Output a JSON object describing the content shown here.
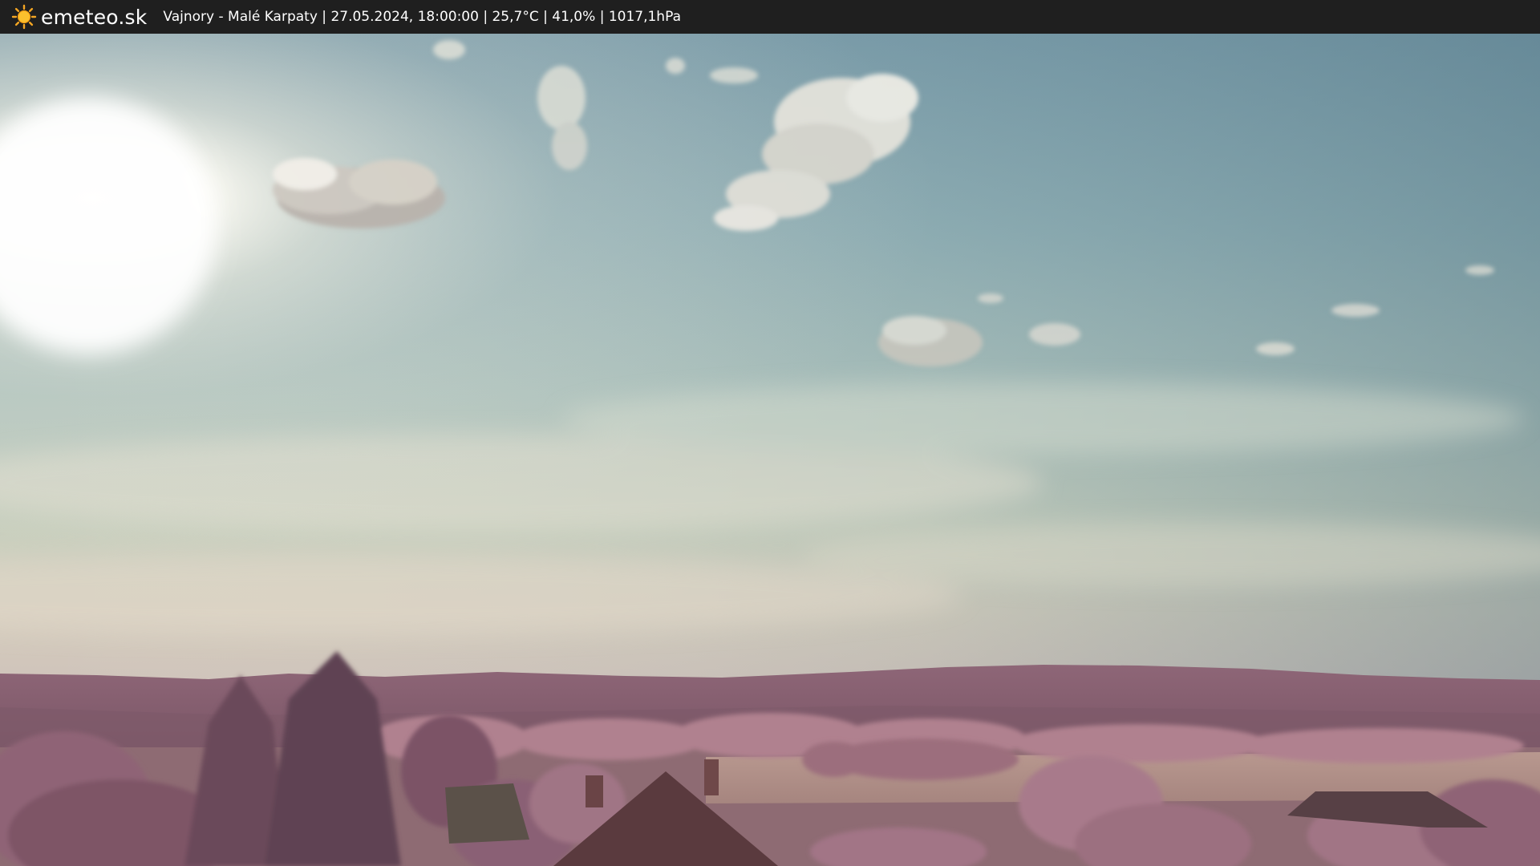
{
  "header": {
    "brand": "emeteo.sk",
    "location": "Vajnory - Malé Karpaty",
    "datetime": "27.05.2024, 18:00:00",
    "temperature": "25,7°C",
    "humidity": "41,0%",
    "pressure": "1017,1hPa",
    "logo_icon": "sun-icon",
    "bar_color": "#1f1f1f",
    "text_color": "#ffffff"
  }
}
